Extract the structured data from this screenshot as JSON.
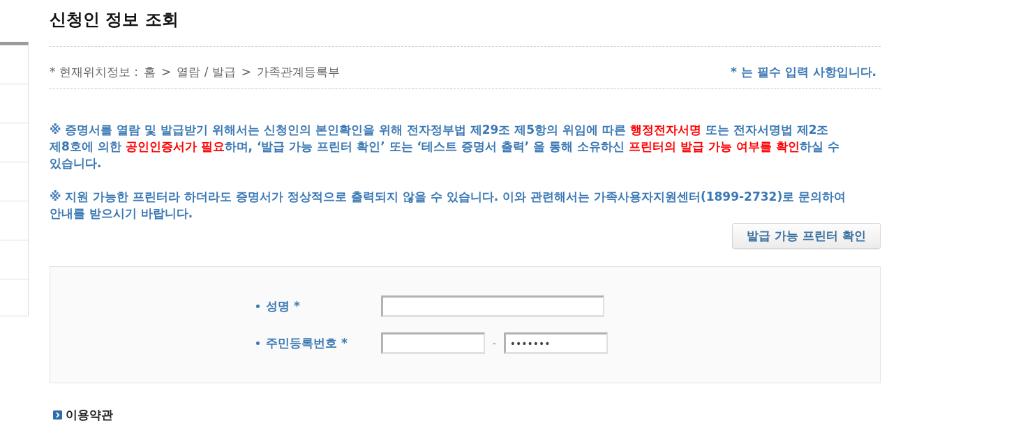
{
  "page": {
    "title": "신청인 정보 조회"
  },
  "breadcrumb": {
    "prefix": "* 현재위치정보 :",
    "items": [
      {
        "label": "홈"
      },
      {
        "label": "열람 / 발급"
      },
      {
        "label": "가족관계등록부"
      }
    ],
    "separators": [
      ">",
      ">"
    ]
  },
  "required_note": "* 는 필수 입력 사항입니다.",
  "notices": [
    {
      "segments": [
        {
          "text": "※ 증명서를 열람 및 발급받기 위해서는 신청인의 본인확인을 위해 전자정부법 제29조 제5항의 위임에 따른 ",
          "highlight": false
        },
        {
          "text": "행정전자서명",
          "highlight": true
        },
        {
          "text": " 또는 전자서명법 제2조 제8호에 의한 ",
          "highlight": false
        },
        {
          "text": "공인인증서가 필요",
          "highlight": true
        },
        {
          "text": "하며, ‘발급 가능 프린터 확인’ 또는 ‘테스트 증명서 출력’ 을 통해 소유하신 ",
          "highlight": false
        },
        {
          "text": "프린터의 발급 가능 여부를 확인",
          "highlight": true
        },
        {
          "text": "하실 수 있습니다.",
          "highlight": false
        }
      ]
    },
    {
      "segments": [
        {
          "text": "※ 지원 가능한 프린터라 하더라도 증명서가 정상적으로 출력되지 않을 수 있습니다. 이와 관련해서는 가족사용자지원센터(1899-2732)로 문의하여 안내를 받으시기 바랍니다.",
          "highlight": false
        }
      ]
    }
  ],
  "check_button": {
    "label": "발급 가능 프린터 확인"
  },
  "form": {
    "fields": [
      {
        "kind": "text",
        "label": "성명 *"
      },
      {
        "kind": "split",
        "label": "주민등록번호 *",
        "separator": "-",
        "back_value": "•••••••"
      }
    ]
  },
  "terms": {
    "title": "이용약관"
  }
}
